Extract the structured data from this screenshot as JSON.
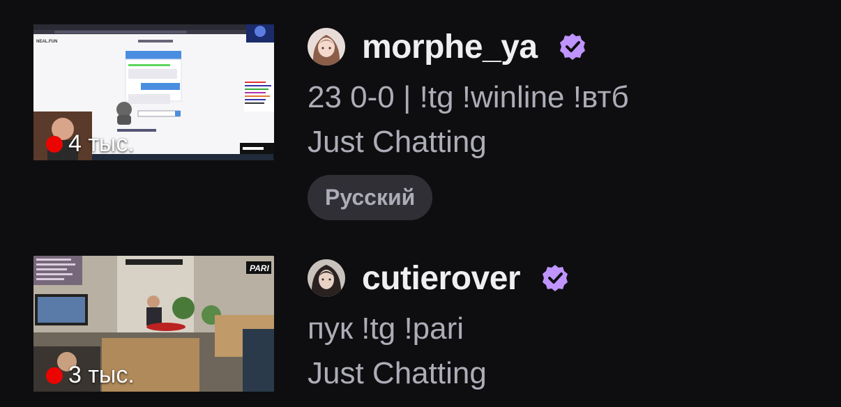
{
  "streams": [
    {
      "channel_name": "morphe_ya",
      "verified_icon": "verified-badge-icon",
      "viewer_count": "4 тыс.",
      "title": "23 0-0 | !tg !winline !втб",
      "category": "Just Chatting",
      "tag": "Русский",
      "thumbnail_text": "NEAL.FUN"
    },
    {
      "channel_name": "cutierover",
      "verified_icon": "verified-badge-icon",
      "viewer_count": "3 тыс.",
      "title": "пук !tg !pari",
      "category": "Just Chatting",
      "thumbnail_text": "PARI"
    }
  ],
  "colors": {
    "background": "#0e0e10",
    "primary_text": "#efeff1",
    "secondary_text": "#adadb8",
    "verified": "#bf94ff",
    "live": "#eb0400",
    "tag_bg": "#2f2f35"
  }
}
